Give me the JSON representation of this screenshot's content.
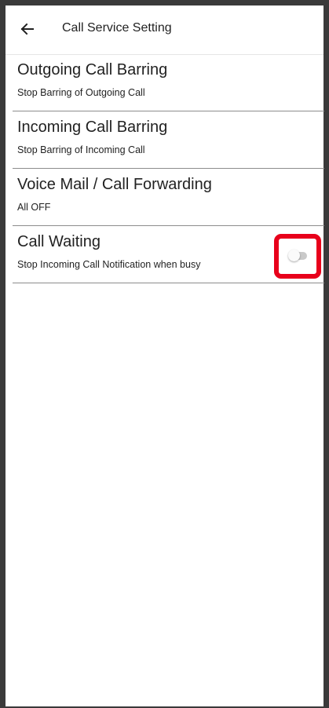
{
  "header": {
    "title": "Call Service Setting",
    "back_icon": "arrow-left-icon"
  },
  "items": [
    {
      "title": "Outgoing Call Barring",
      "subtitle": "Stop Barring of Outgoing Call"
    },
    {
      "title": "Incoming Call Barring",
      "subtitle": "Stop Barring of Incoming Call"
    },
    {
      "title": "Voice Mail / Call Forwarding",
      "subtitle": "All OFF"
    },
    {
      "title": "Call Waiting",
      "subtitle": "Stop Incoming Call Notification when busy"
    }
  ],
  "call_waiting_toggle": {
    "state": "off",
    "highlight_color": "#e8001b"
  }
}
